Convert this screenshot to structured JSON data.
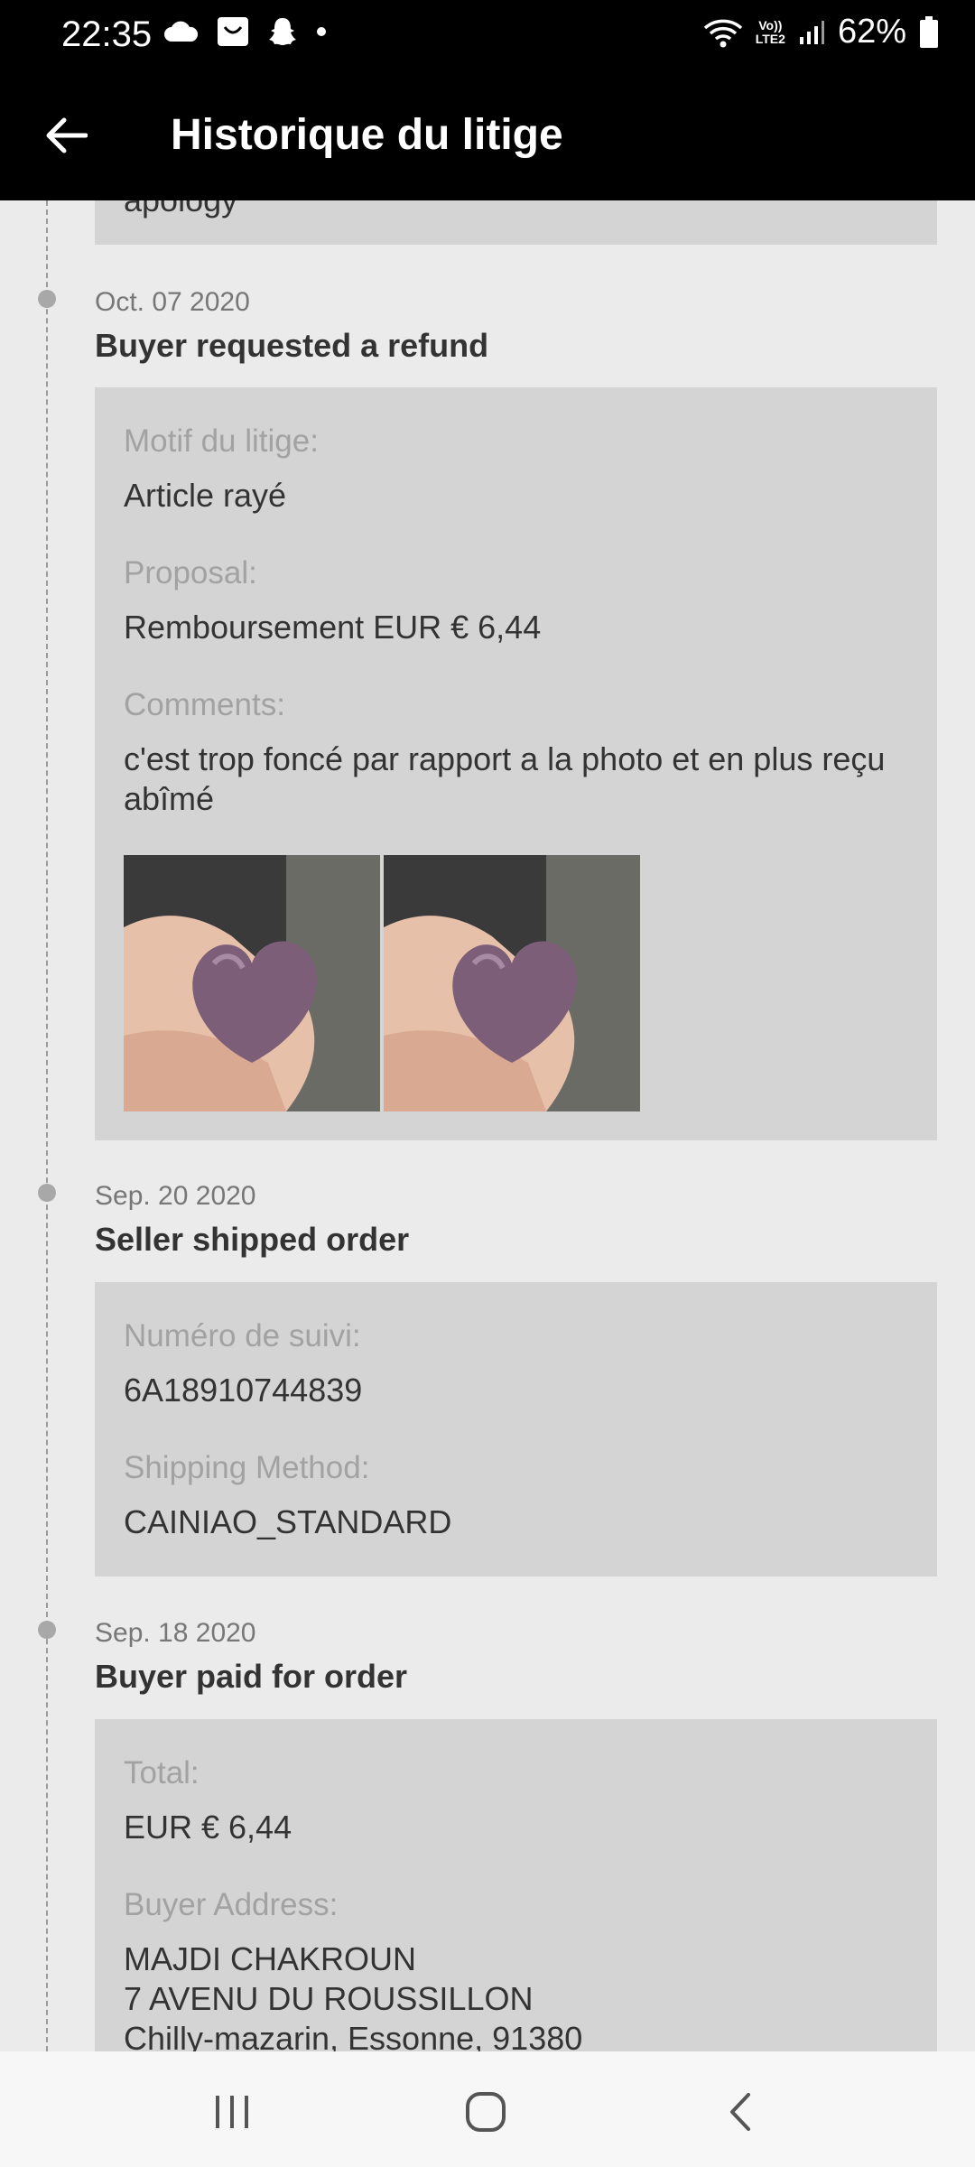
{
  "status_bar": {
    "time": "22:35",
    "battery": "62%",
    "network_top": "Vo))",
    "network_bottom": "LTE2",
    "left_icons": [
      "cloud-icon",
      "inbox-icon",
      "snapchat-icon",
      "dot-icon"
    ],
    "right_icons": [
      "wifi-icon",
      "signal-icon",
      "battery-icon"
    ]
  },
  "header": {
    "title": "Historique du litige",
    "back_icon": "arrow-left-icon"
  },
  "partial_card": {
    "text": "apology"
  },
  "events": [
    {
      "date": "Oct. 07 2020",
      "title": "Buyer requested a refund",
      "fields": [
        {
          "label": "Motif du litige:",
          "value": "Article rayé"
        },
        {
          "label": "Proposal:",
          "value": "Remboursement EUR € 6,44"
        },
        {
          "label": "Comments:",
          "value": "c'est trop foncé par rapport a la photo et en plus reçu abîmé"
        }
      ],
      "images": [
        "heart-photo-1",
        "heart-photo-2"
      ]
    },
    {
      "date": "Sep. 20 2020",
      "title": "Seller shipped order",
      "fields": [
        {
          "label": "Numéro de suivi:",
          "value": "6A18910744839"
        },
        {
          "label": "Shipping Method:",
          "value": "CAINIAO_STANDARD"
        }
      ]
    },
    {
      "date": "Sep. 18 2020",
      "title": "Buyer paid for order",
      "fields": [
        {
          "label": "Total:",
          "value": "EUR € 6,44"
        },
        {
          "label": "Buyer Address:",
          "value_lines": [
            "MAJDI CHAKROUN",
            "7 AVENU DU ROUSSILLON",
            "Chilly-mazarin, Essonne, 91380"
          ]
        }
      ]
    }
  ],
  "nav_bar": {
    "icons": [
      "recent-apps-icon",
      "home-icon",
      "back-icon"
    ]
  },
  "colors": {
    "bar_background": "#000000",
    "page_background": "#ebebeb",
    "card_background": "#d4d4d4",
    "label_color": "#a2a2a2",
    "text_color": "#333333"
  }
}
